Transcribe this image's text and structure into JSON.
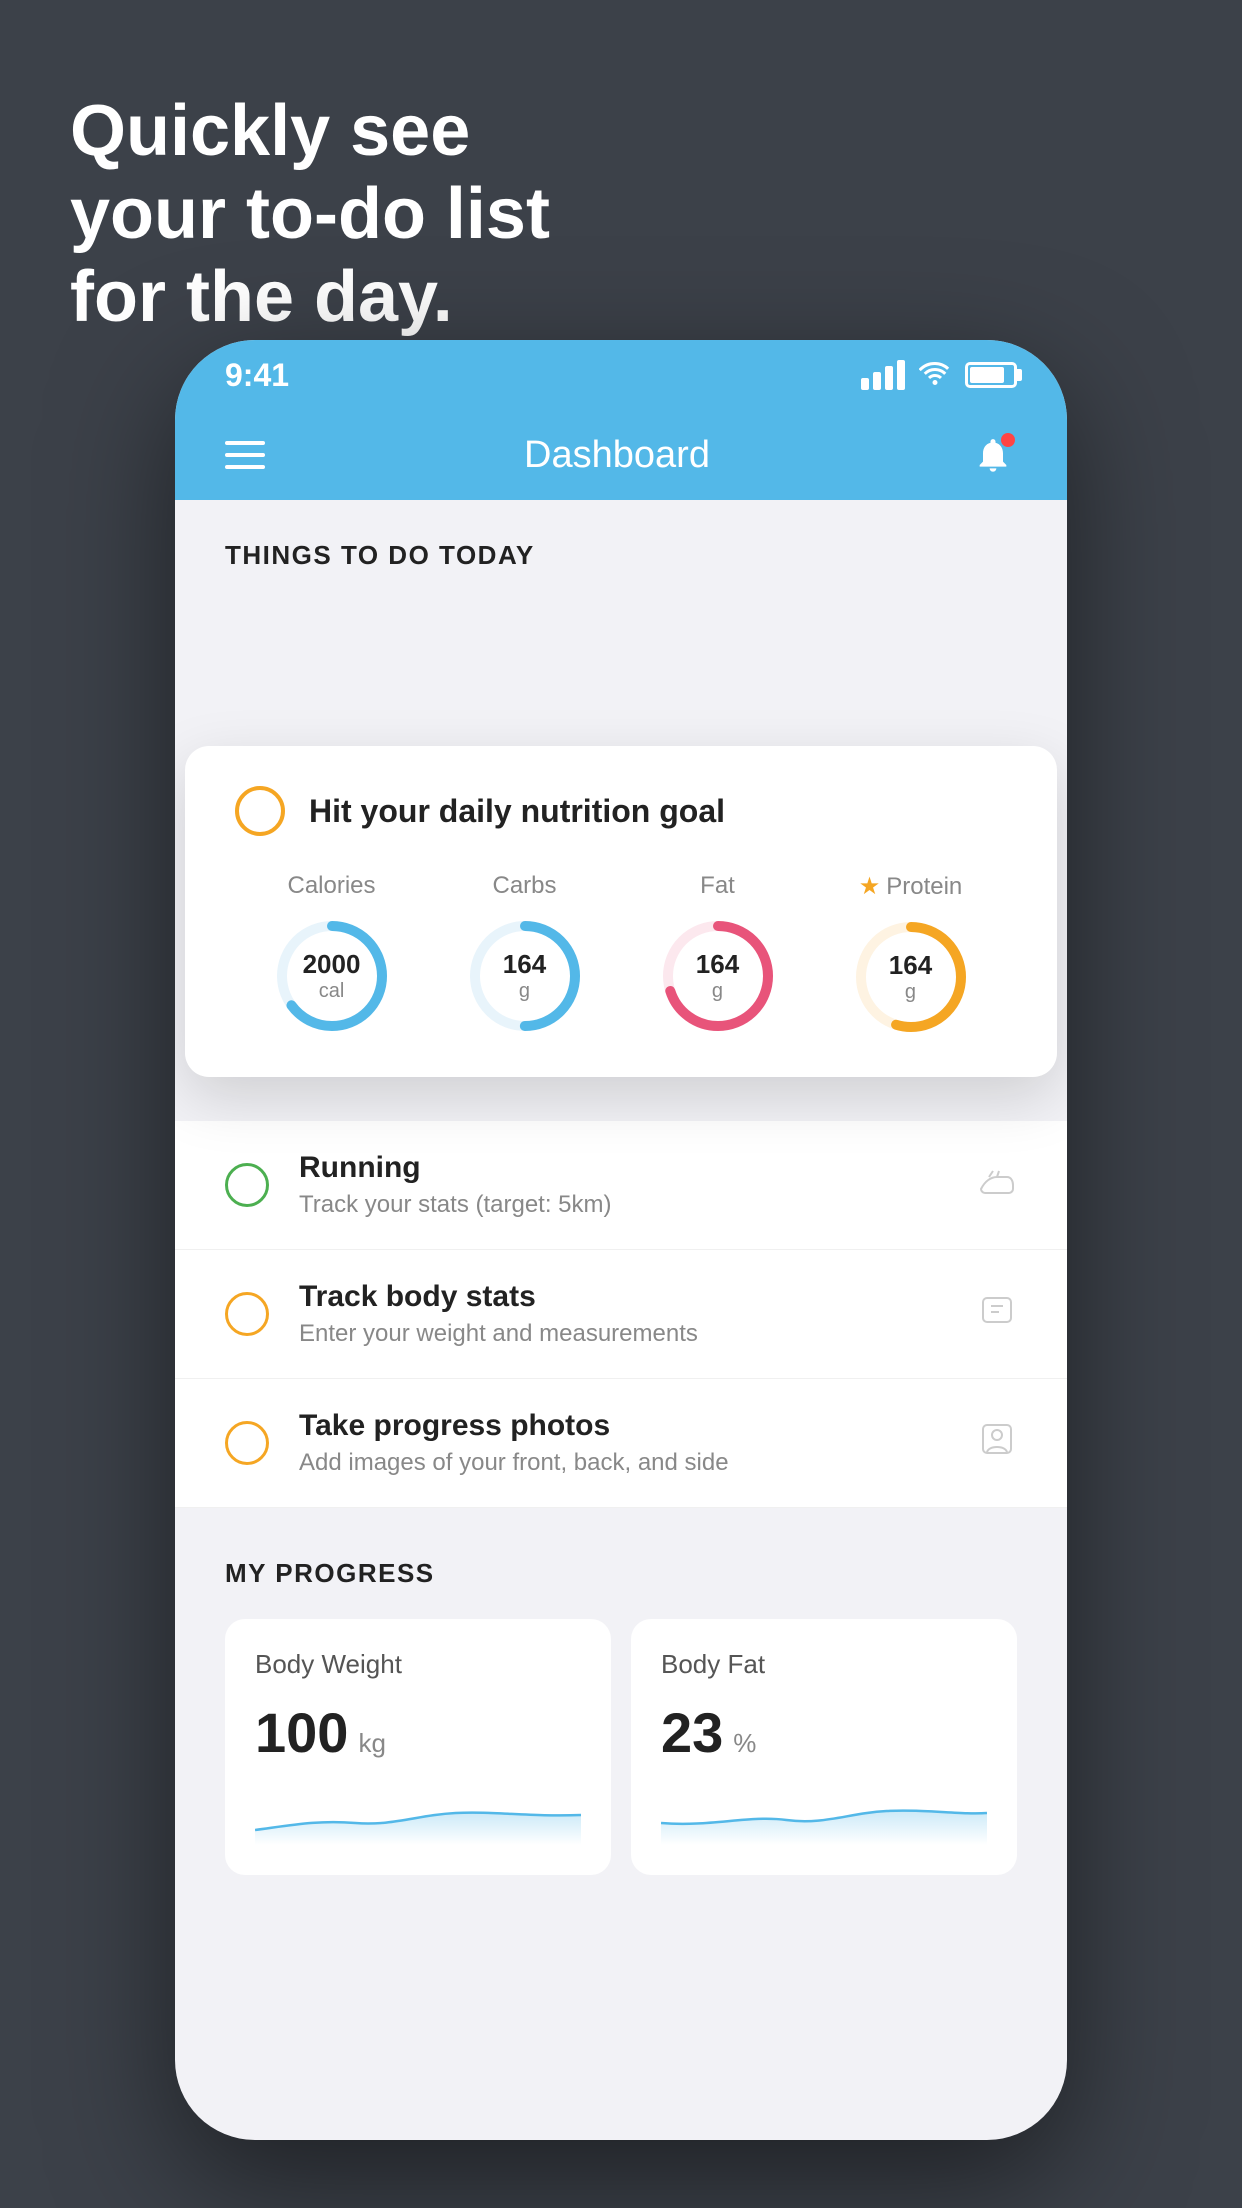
{
  "hero": {
    "line1": "Quickly see",
    "line2": "your to-do list",
    "line3": "for the day."
  },
  "status_bar": {
    "time": "9:41"
  },
  "nav": {
    "title": "Dashboard"
  },
  "things_today": {
    "section_title": "THINGS TO DO TODAY"
  },
  "nutrition_card": {
    "title": "Hit your daily nutrition goal",
    "items": [
      {
        "label": "Calories",
        "value": "2000",
        "unit": "cal",
        "color": "#53b8e8",
        "track_color": "#e8f4fb",
        "percent": 65
      },
      {
        "label": "Carbs",
        "value": "164",
        "unit": "g",
        "color": "#53b8e8",
        "track_color": "#e8f4fb",
        "percent": 50
      },
      {
        "label": "Fat",
        "value": "164",
        "unit": "g",
        "color": "#e8547a",
        "track_color": "#fce8ee",
        "percent": 70
      },
      {
        "label": "Protein",
        "value": "164",
        "unit": "g",
        "color": "#f5a623",
        "track_color": "#fef3e2",
        "percent": 55,
        "starred": true
      }
    ]
  },
  "todo_items": [
    {
      "title": "Running",
      "subtitle": "Track your stats (target: 5km)",
      "circle_color": "green",
      "icon": "shoe"
    },
    {
      "title": "Track body stats",
      "subtitle": "Enter your weight and measurements",
      "circle_color": "yellow",
      "icon": "scale"
    },
    {
      "title": "Take progress photos",
      "subtitle": "Add images of your front, back, and side",
      "circle_color": "yellow",
      "icon": "person"
    }
  ],
  "progress": {
    "section_title": "MY PROGRESS",
    "cards": [
      {
        "title": "Body Weight",
        "value": "100",
        "unit": "kg"
      },
      {
        "title": "Body Fat",
        "value": "23",
        "unit": "%"
      }
    ]
  }
}
